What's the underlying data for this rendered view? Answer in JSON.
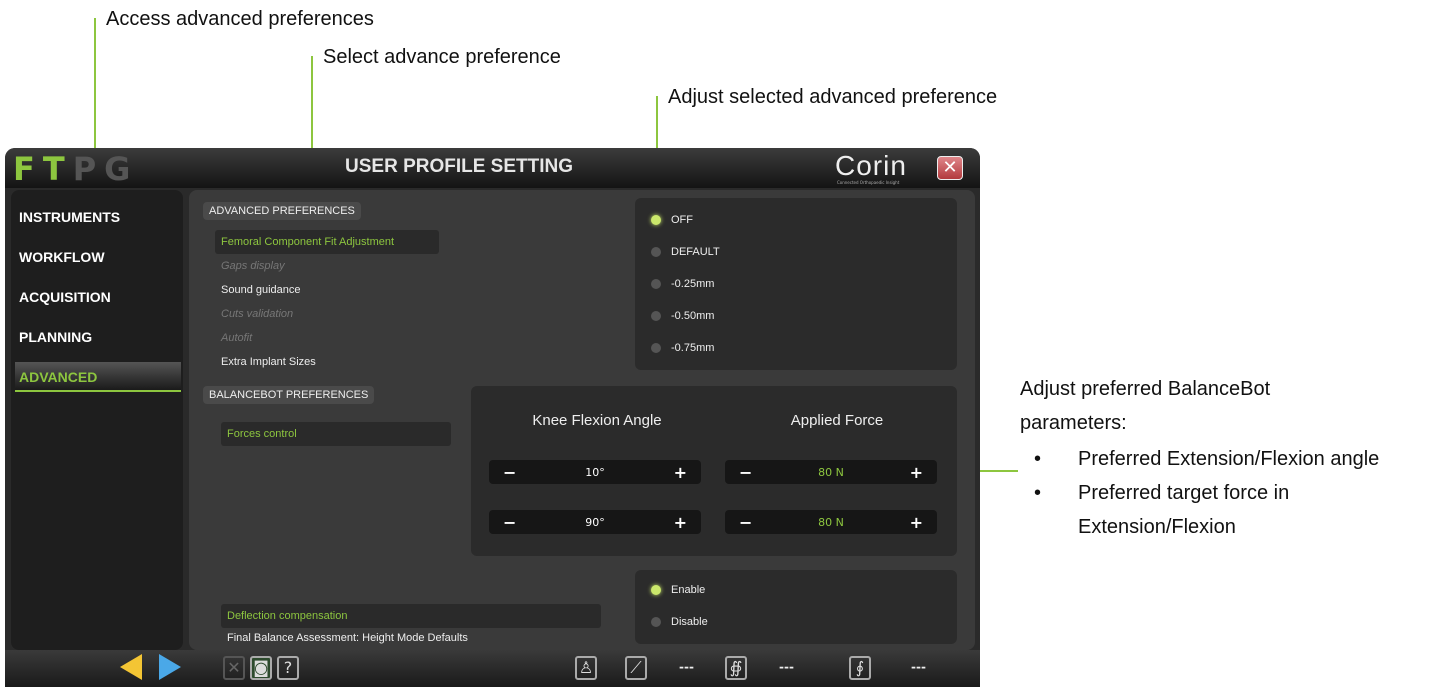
{
  "annotations": {
    "access_advanced": "Access advanced preferences",
    "select_advance": "Select advance preference",
    "adjust_selected": "Adjust selected advanced preference",
    "balancebot_title_1": "Adjust preferred BalanceBot",
    "balancebot_title_2": "parameters:",
    "bullets": [
      "Preferred Extension/Flexion angle",
      "Preferred target force in",
      "Extension/Flexion"
    ]
  },
  "app": {
    "logo_letters": [
      "F",
      "T",
      "P",
      "G"
    ],
    "title": "USER PROFILE SETTING",
    "brand": "Corin",
    "brand_tagline": "Connected Orthopaedic Insight",
    "close_glyph": "✕"
  },
  "sidebar": {
    "items": [
      {
        "label": "INSTRUMENTS"
      },
      {
        "label": "WORKFLOW"
      },
      {
        "label": "ACQUISITION"
      },
      {
        "label": "PLANNING"
      },
      {
        "label": "ADVANCED"
      }
    ]
  },
  "advanced": {
    "section_title": "ADVANCED PREFERENCES",
    "prefs": [
      "Femoral Component Fit Adjustment",
      "Gaps display",
      "Sound guidance",
      "Cuts validation",
      "Autofit",
      "Extra Implant Sizes"
    ],
    "options": [
      "OFF",
      "DEFAULT",
      "-0.25mm",
      "-0.50mm",
      "-0.75mm"
    ],
    "selected_option": "OFF"
  },
  "balancebot": {
    "section_title": "BALANCEBOT PREFERENCES",
    "forces_label": "Forces control",
    "col_angle": "Knee Flexion Angle",
    "col_force": "Applied Force",
    "angle_values": [
      "10°",
      "90°"
    ],
    "force_values": [
      "80 N",
      "80 N"
    ],
    "minus": "−",
    "plus": "+"
  },
  "deflection": {
    "label": "Deflection compensation",
    "final_label": "Final Balance Assessment: Height Mode Defaults",
    "options": [
      "Enable",
      "Disable"
    ],
    "selected_option": "Enable"
  },
  "bottombar": {
    "help": "?",
    "dashes": [
      "---",
      "---",
      "---"
    ]
  },
  "colors": {
    "accent": "#8dc63f",
    "prev_arrow": "#f3c534",
    "next_arrow": "#4aa8e8"
  }
}
